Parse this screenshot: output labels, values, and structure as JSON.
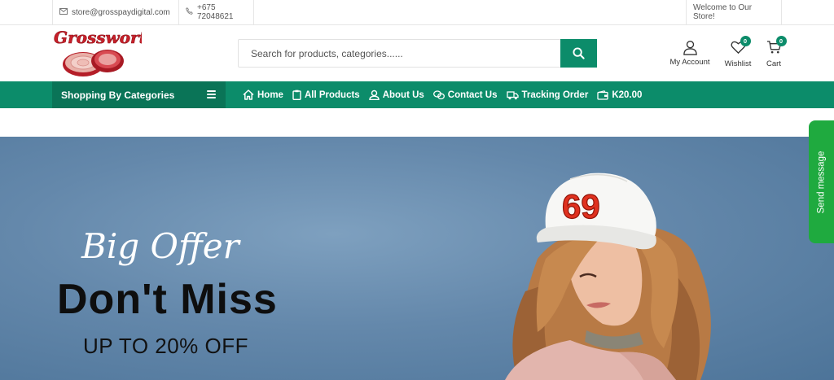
{
  "topbar": {
    "email": "store@grosspaydigital.com",
    "phone": "+675 72048621",
    "welcome": "Welcome to Our Store!"
  },
  "brand": {
    "logo_text": "Grossworth",
    "accent": "#0c8c6a",
    "logo_red": "#c8202a"
  },
  "search": {
    "placeholder": "Search for products, categories......"
  },
  "header_icons": {
    "account_label": "My Account",
    "wishlist_label": "Wishlist",
    "wishlist_count": "0",
    "cart_label": "Cart",
    "cart_count": "0"
  },
  "nav": {
    "categories_label": "Shopping By Categories",
    "links": [
      {
        "label": "Home",
        "icon": "home-icon"
      },
      {
        "label": "All Products",
        "icon": "clipboard-icon"
      },
      {
        "label": "About Us",
        "icon": "user-icon"
      },
      {
        "label": "Contact Us",
        "icon": "chat-icon"
      },
      {
        "label": "Tracking Order",
        "icon": "truck-icon"
      },
      {
        "label": "K20.00",
        "icon": "wallet-icon"
      }
    ]
  },
  "hero": {
    "script_text": "Big Offer",
    "headline": "Don't Miss",
    "subline": "UP TO 20% OFF",
    "cap_number": "69"
  },
  "chat_widget": {
    "label": "Send message",
    "color": "#1faa3f"
  }
}
